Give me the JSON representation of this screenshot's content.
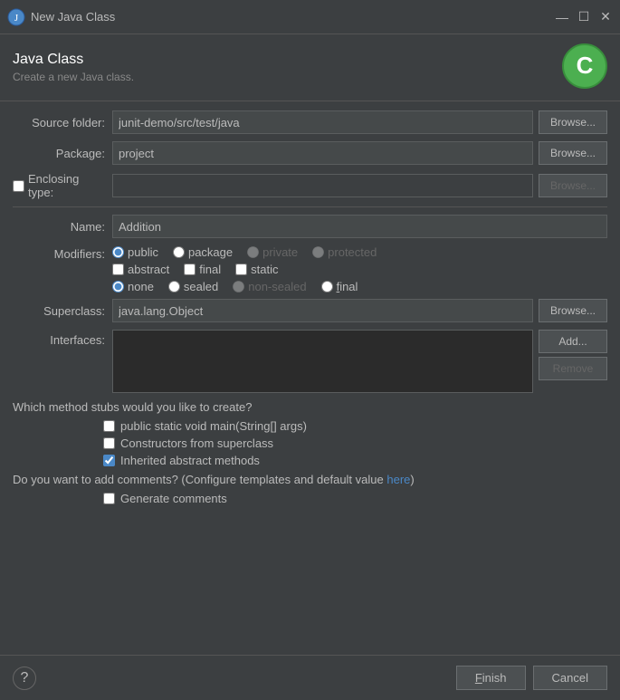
{
  "titleBar": {
    "title": "New Java Class",
    "icon": "☕",
    "minimize": "—",
    "maximize": "☐",
    "close": "✕"
  },
  "header": {
    "title": "Java Class",
    "subtitle": "Create a new Java class.",
    "logoColor": "#4caf50"
  },
  "form": {
    "sourceFolder": {
      "label": "Source folder:",
      "value": "junit-demo/src/test/java",
      "browseLabel": "Browse..."
    },
    "package": {
      "label": "Package:",
      "value": "project",
      "browseLabel": "Browse..."
    },
    "enclosingType": {
      "label": "Enclosing type:",
      "checked": false,
      "value": "",
      "browseLabel": "Browse..."
    },
    "name": {
      "label": "Name:",
      "value": "Addition"
    },
    "modifiers": {
      "label": "Modifiers:",
      "visibility": [
        {
          "id": "mod-public",
          "label": "public",
          "checked": true,
          "disabled": false
        },
        {
          "id": "mod-package",
          "label": "package",
          "checked": false,
          "disabled": false
        },
        {
          "id": "mod-private",
          "label": "private",
          "checked": false,
          "disabled": true
        },
        {
          "id": "mod-protected",
          "label": "protected",
          "checked": false,
          "disabled": true
        }
      ],
      "type": [
        {
          "id": "mod-abstract",
          "label": "abstract",
          "checked": false,
          "disabled": false
        },
        {
          "id": "mod-final",
          "label": "final",
          "checked": false,
          "disabled": false
        },
        {
          "id": "mod-static",
          "label": "static",
          "checked": false,
          "disabled": false
        }
      ],
      "sealed": [
        {
          "id": "mod-none",
          "label": "none",
          "checked": true,
          "disabled": false
        },
        {
          "id": "mod-sealed",
          "label": "sealed",
          "checked": false,
          "disabled": false
        },
        {
          "id": "mod-non-sealed",
          "label": "non-sealed",
          "checked": false,
          "disabled": true
        },
        {
          "id": "mod-final2",
          "label": "final",
          "checked": false,
          "disabled": false
        }
      ]
    },
    "superclass": {
      "label": "Superclass:",
      "value": "java.lang.Object",
      "browseLabel": "Browse..."
    },
    "interfaces": {
      "label": "Interfaces:",
      "addLabel": "Add...",
      "removeLabel": "Remove"
    }
  },
  "methodStubs": {
    "question": "Which method stubs would you like to create?",
    "items": [
      {
        "id": "stub-main",
        "label": "public static void main(String[] args)",
        "checked": false
      },
      {
        "id": "stub-constructors",
        "label": "Constructors from superclass",
        "checked": false
      },
      {
        "id": "stub-inherited",
        "label": "Inherited abstract methods",
        "checked": true
      }
    ]
  },
  "comments": {
    "question": "Do you want to add comments? (Configure templates and default value ",
    "linkLabel": "here",
    "questionEnd": ")",
    "items": [
      {
        "id": "comment-generate",
        "label": "Generate comments",
        "checked": false
      }
    ]
  },
  "footer": {
    "helpLabel": "?",
    "finishLabel": "Finish",
    "cancelLabel": "Cancel"
  }
}
